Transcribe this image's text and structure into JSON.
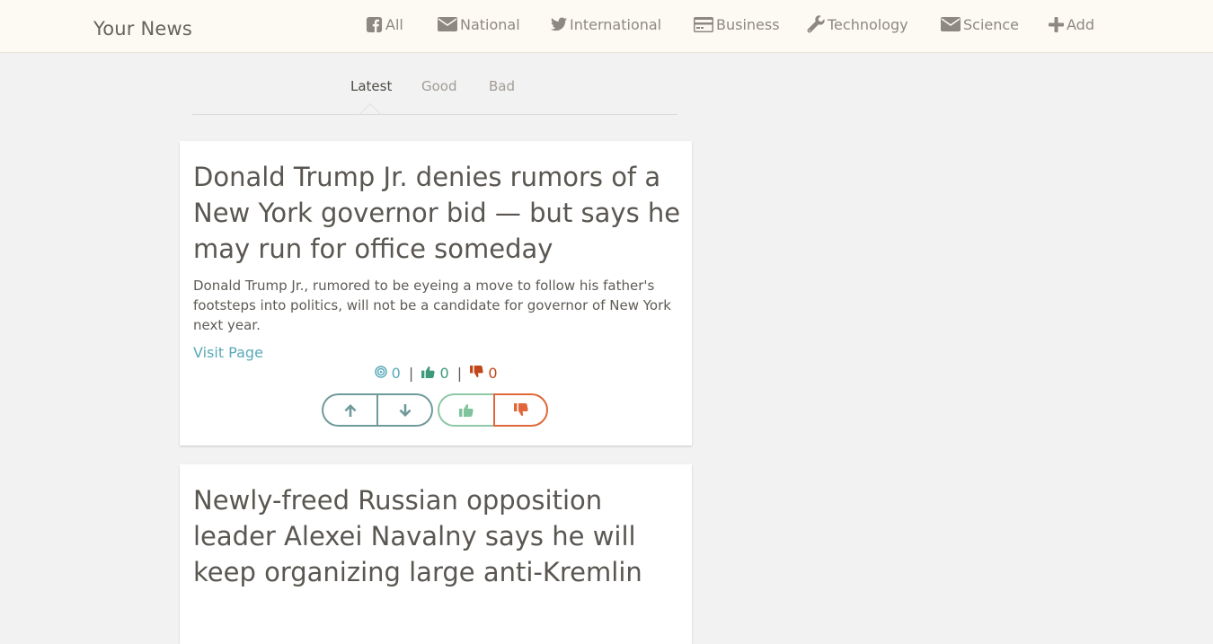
{
  "header": {
    "brand": "Your News",
    "nav": [
      {
        "label": "All",
        "icon": "facebook-icon"
      },
      {
        "label": "National",
        "icon": "envelope-icon"
      },
      {
        "label": "International",
        "icon": "twitter-icon"
      },
      {
        "label": "Business",
        "icon": "credit-card-icon"
      },
      {
        "label": "Technology",
        "icon": "wrench-icon"
      },
      {
        "label": "Science",
        "icon": "envelope-icon"
      },
      {
        "label": "Add",
        "icon": "plus-icon"
      }
    ]
  },
  "tabs": [
    {
      "label": "Latest",
      "active": true
    },
    {
      "label": "Good",
      "active": false
    },
    {
      "label": "Bad",
      "active": false
    }
  ],
  "articles": [
    {
      "title": "Donald Trump Jr. denies rumors of a New York governor bid — but says he may run for office someday",
      "description": "Donald Trump Jr., rumored to be eyeing a move to follow his father's footsteps into politics, will not be a candidate for governor of New York next year.",
      "link_label": "Visit Page",
      "views": "0",
      "likes": "0",
      "dislikes": "0"
    },
    {
      "title": "Newly-freed Russian opposition leader Alexei Navalny says he will keep organizing large anti-Kremlin"
    }
  ],
  "colors": {
    "accent_teal": "#5aa9b8",
    "good_green": "#3d9a7a",
    "bad_red": "#c0461b",
    "header_bg": "#fdfaf3",
    "page_bg": "#f2f2f2"
  }
}
